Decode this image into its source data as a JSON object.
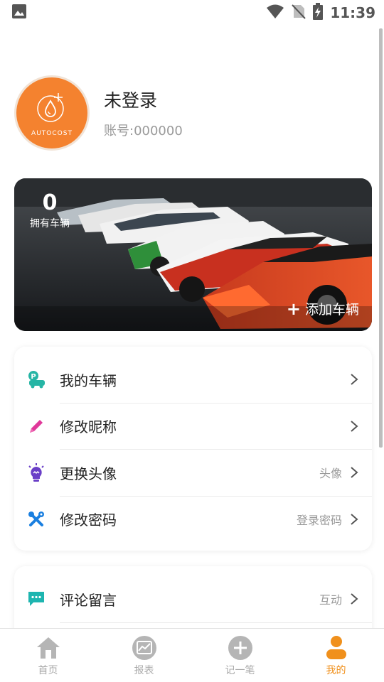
{
  "status_bar": {
    "time": "11:39",
    "icons": [
      "image-icon",
      "wifi-icon",
      "no-sim-icon",
      "battery-icon"
    ]
  },
  "profile": {
    "avatar_text": "AUTOCOST",
    "name": "未登录",
    "account": "账号:000000"
  },
  "vehicle_banner": {
    "count": "0",
    "count_label": "拥有车辆",
    "add_label": "添加车辆"
  },
  "menu_group_1": [
    {
      "label": "我的车辆",
      "value": "",
      "icon": "car-parking-icon",
      "color": "#26b5a5"
    },
    {
      "label": "修改昵称",
      "value": "",
      "icon": "pencil-icon",
      "color": "#e0389a"
    },
    {
      "label": "更换头像",
      "value": "头像",
      "icon": "lightbulb-icon",
      "color": "#6a3fc7"
    },
    {
      "label": "修改密码",
      "value": "登录密码",
      "icon": "tools-icon",
      "color": "#1a7fe0"
    }
  ],
  "menu_group_2": [
    {
      "label": "评论留言",
      "value": "互动",
      "icon": "comment-icon",
      "color": "#1eb5b0"
    }
  ],
  "bottom_nav": [
    {
      "label": "首页",
      "icon": "home-icon",
      "active": false
    },
    {
      "label": "报表",
      "icon": "chart-icon",
      "active": false
    },
    {
      "label": "记一笔",
      "icon": "add-circle-icon",
      "active": false
    },
    {
      "label": "我的",
      "icon": "person-icon",
      "active": true
    }
  ],
  "colors": {
    "accent": "#f0901c",
    "avatar_bg": "#f4822f",
    "inactive": "#aaaaaa"
  }
}
